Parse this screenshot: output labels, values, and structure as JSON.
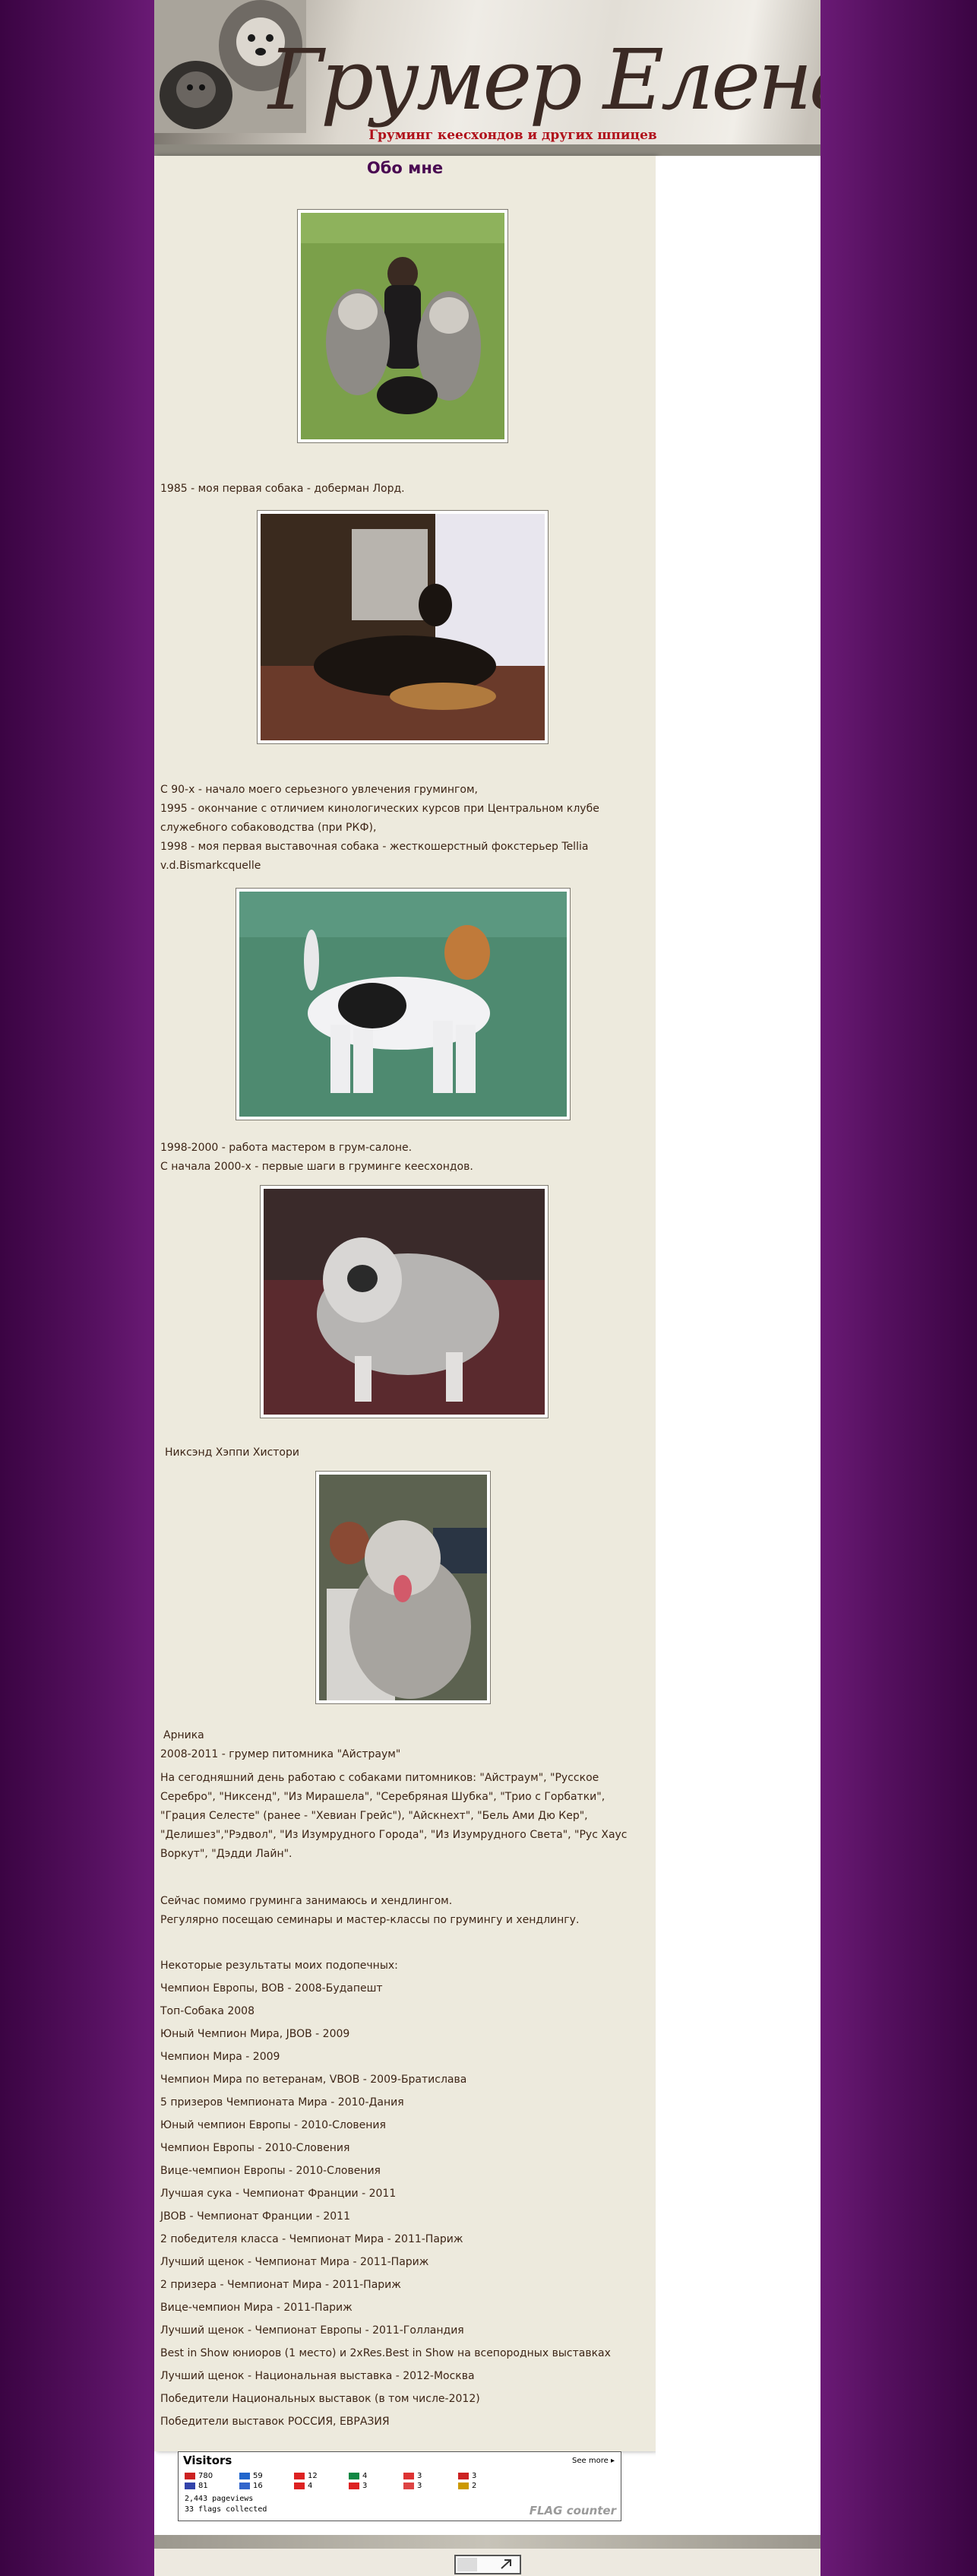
{
  "header": {
    "title": "Грумер Елена Пашкевич",
    "subtitle": "Груминг кеесхондов и других шпицев"
  },
  "main": {
    "title": "Обо мне",
    "blocks": [
      {
        "id": "b1",
        "lines": [
          "1985 - моя первая собака - доберман Лорд."
        ]
      },
      {
        "id": "b2",
        "lines": [
          "С 90-х - начало моего серьезного увлечения грумингом,",
          "1995 - окончание с отличием кинологических курсов при Центральном клубе служебного собаководства (при РКФ),",
          "1998 - моя первая выставочная собака - жесткошерстный фокстерьер Tellia v.d.Bismarkcquelle"
        ]
      },
      {
        "id": "b3",
        "lines": [
          "1998-2000 - работа мастером в грум-салоне.",
          "С начала 2000-х - первые шаги в груминге кеесхондов."
        ]
      },
      {
        "id": "b4",
        "lines": [
          "Никсэнд Хэппи Хистори"
        ]
      },
      {
        "id": "b5",
        "lines": [
          "Арника",
          "2008-2011 - грумер питомника \"Айстраум\"",
          "На сегодняшний день работаю с собаками питомников: \"Айстраум\", \"Русское Серебро\", \"Никсенд\",  \"Из Мирашела\", \"Серебряная Шубка\", \"Трио с Горбатки\", \"Грация Селесте\" (ранее - \"Хевиан Грейс\"), \"Айскнехт\", \"Бель Ами Дю Кер\", \"Делишез\",\"Рэдвол\", \"Из Изумрудного Города\", \"Из Изумрудного Света\", \"Рус Хаус Воркут\", \"Дэдди Лайн\"."
        ]
      },
      {
        "id": "b6",
        "lines": [
          "Сейчас помимо груминга занимаюсь и хендлингом.",
          "Регулярно посещаю семинары и мастер-классы по грумингу и хендлингу."
        ]
      }
    ],
    "results_intro": "Некоторые результаты моих подопечных:",
    "results": [
      "Чемпион Европы, ВОВ - 2008-Будапешт",
      "Топ-Собака 2008",
      "Юный Чемпион Мира, JBOB - 2009",
      "Чемпион Мира - 2009",
      "Чемпион Мира по ветеранам, VBOB - 2009-Братислава",
      "5 призеров Чемпионата Мира - 2010-Дания",
      "Юный чемпион Европы - 2010-Словения",
      "Чемпион Европы - 2010-Словения",
      "Вице-чемпион Европы - 2010-Словения",
      "Лучшая сука - Чемпионат Франции - 2011",
      "JBOB - Чемпионат Франции - 2011",
      "2 победителя класса - Чемпионат Мира - 2011-Париж",
      "Лучший щенок - Чемпионат Мира - 2011-Париж",
      "2 призера - Чемпионат Мира - 2011-Париж",
      "Вице-чемпион Мира - 2011-Париж",
      "Лучший щенок - Чемпионат Европы - 2011-Голландия",
      "Best in Show юниоров (1 место) и 2xRes.Best in Show на всепородных выставках",
      "Лучший щенок - Национальная выставка - 2012-Москва",
      "Победители Национальных выставок (в том числе-2012)",
      "Победители выставок РОССИЯ, ЕВРАЗИЯ"
    ]
  },
  "widget": {
    "title": "Visitors",
    "see_more": "See more",
    "flags": [
      {
        "count": "780",
        "color": "#cc2222"
      },
      {
        "count": "59",
        "color": "#2266cc"
      },
      {
        "count": "12",
        "color": "#dd2222"
      },
      {
        "count": "4",
        "color": "#118844"
      },
      {
        "count": "3",
        "color": "#dd3333"
      },
      {
        "count": "3",
        "color": "#cc2222"
      },
      {
        "count": "81",
        "color": "#3344aa"
      },
      {
        "count": "16",
        "color": "#3366cc"
      },
      {
        "count": "4",
        "color": "#dd2222"
      },
      {
        "count": "3",
        "color": "#dd2222"
      },
      {
        "count": "3",
        "color": "#dd4444"
      },
      {
        "count": "2",
        "color": "#cc9900"
      }
    ],
    "pageviews": "2,443 pageviews",
    "flags_collected": "33 flags collected",
    "brand": "FLAG counter"
  }
}
